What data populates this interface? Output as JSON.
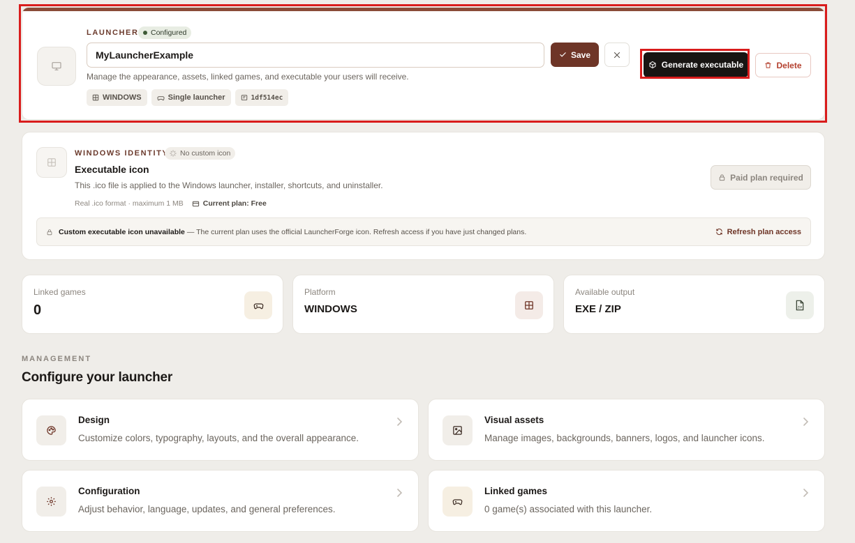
{
  "header": {
    "kicker": "LAUNCHER",
    "status": "Configured",
    "name_value": "MyLauncherExample",
    "save_label": "Save",
    "description": "Manage the appearance, assets, linked games, and executable your users will receive.",
    "tags": [
      "WINDOWS",
      "Single launcher",
      "1df514ec"
    ],
    "generate_label": "Generate executable",
    "delete_label": "Delete"
  },
  "identity": {
    "kicker": "WINDOWS IDENTITY",
    "badge": "No custom icon",
    "title": "Executable icon",
    "description": "This .ico file is applied to the Windows launcher, installer, shortcuts, and uninstaller.",
    "format_note": "Real .ico format · maximum 1 MB",
    "current_plan": "Current plan: Free",
    "paid_label": "Paid plan required",
    "notice_title": "Custom executable icon unavailable",
    "notice_body": "— The current plan uses the official LauncherForge icon. Refresh access if you have just changed plans.",
    "refresh_label": "Refresh plan access"
  },
  "stats": [
    {
      "label": "Linked games",
      "value": "0",
      "icon": "gamepad-icon"
    },
    {
      "label": "Platform",
      "value": "WINDOWS",
      "icon": "windows-icon"
    },
    {
      "label": "Available output",
      "value": "EXE / ZIP",
      "icon": "zip-file-icon"
    }
  ],
  "management": {
    "kicker": "MANAGEMENT",
    "title": "Configure your launcher",
    "cards": [
      {
        "title": "Design",
        "description": "Customize colors, typography, layouts, and the overall appearance.",
        "icon": "palette-icon"
      },
      {
        "title": "Visual assets",
        "description": "Manage images, backgrounds, banners, logos, and launcher icons.",
        "icon": "image-icon"
      },
      {
        "title": "Configuration",
        "description": "Adjust behavior, language, updates, and general preferences.",
        "icon": "gear-icon"
      },
      {
        "title": "Linked games",
        "description": "0 game(s) associated with this launcher.",
        "icon": "gamepad-icon"
      }
    ]
  },
  "colors": {
    "accent": "#6e3527",
    "header_bar": "#8a4b38",
    "highlight": "#d91c1c",
    "background": "#efede9",
    "delete": "#b4412f"
  }
}
